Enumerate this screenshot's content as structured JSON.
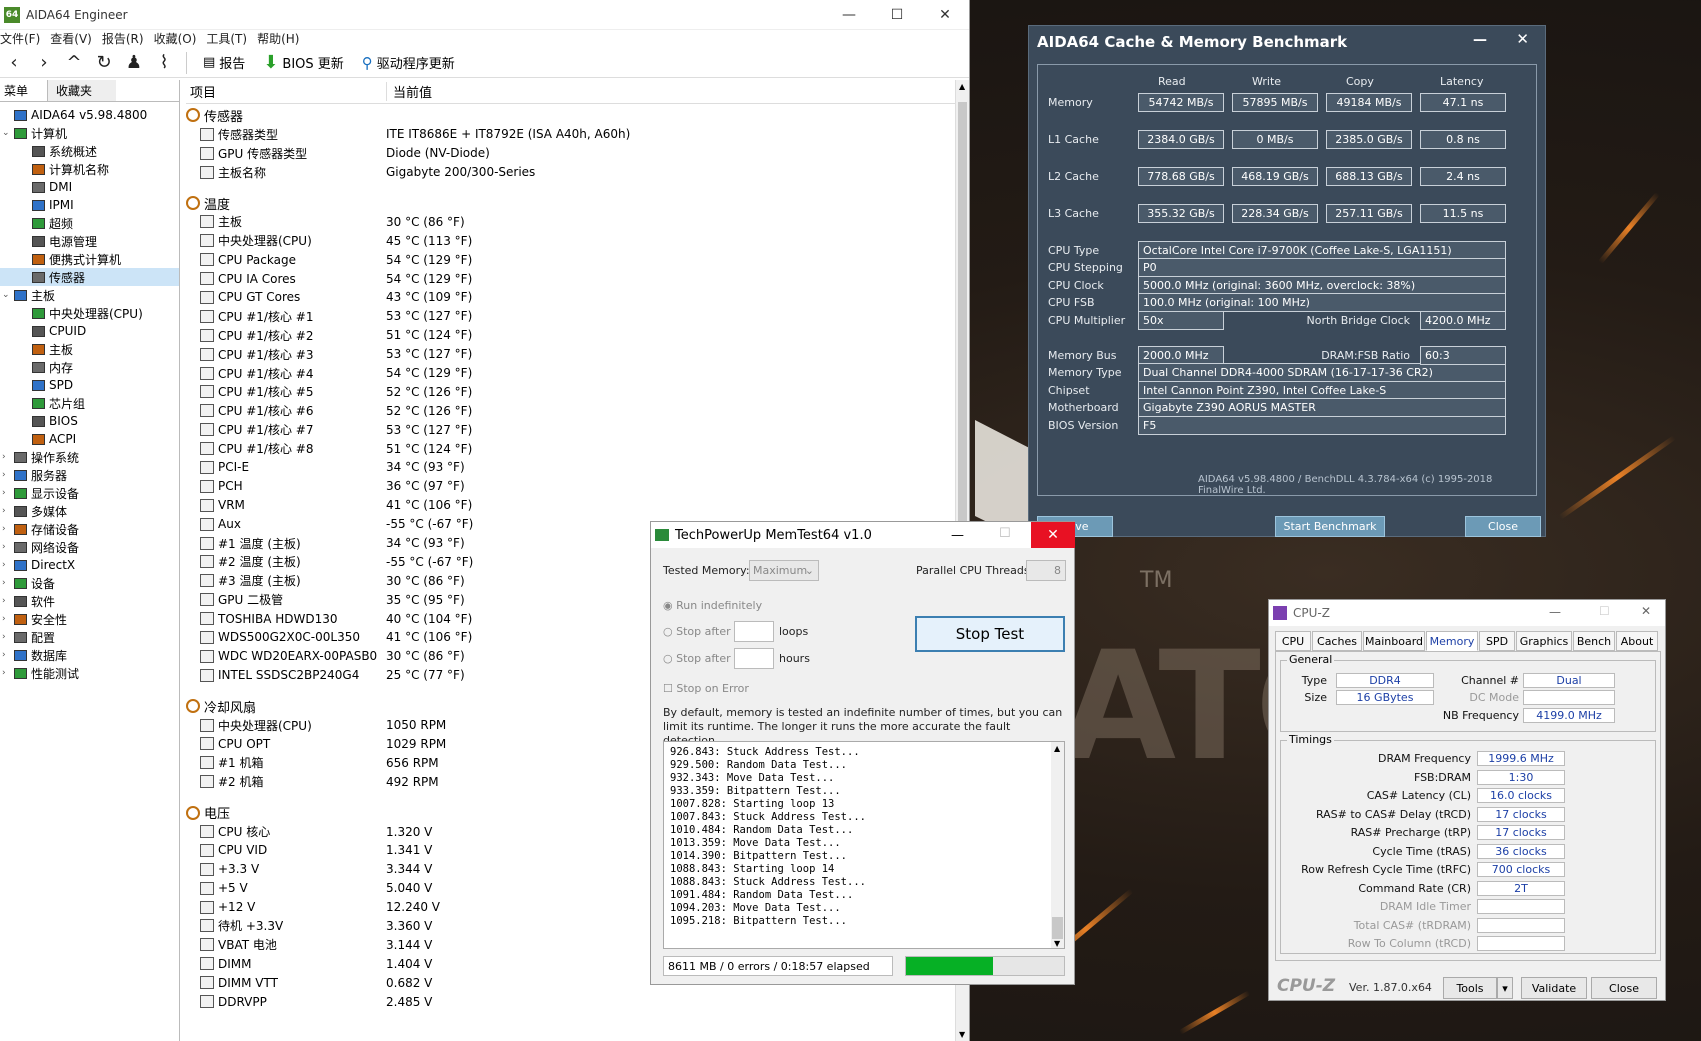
{
  "aida": {
    "window_title": "AIDA64 Engineer",
    "app_badge": "64",
    "menu": [
      "文件(F)",
      "查看(V)",
      "报告(R)",
      "收藏(O)",
      "工具(T)",
      "帮助(H)"
    ],
    "toolbar": {
      "report": "报告",
      "bios_update": "BIOS 更新",
      "driver_update": "驱动程序更新"
    },
    "side_tabs": [
      "菜单",
      "收藏夹"
    ],
    "tree": [
      {
        "label": "AIDA64 v5.98.4800",
        "level": 0,
        "arrow": ""
      },
      {
        "label": "计算机",
        "level": 0,
        "arrow": "v"
      },
      {
        "label": "系统概述",
        "level": 1,
        "arrow": ""
      },
      {
        "label": "计算机名称",
        "level": 1,
        "arrow": ""
      },
      {
        "label": "DMI",
        "level": 1,
        "arrow": ""
      },
      {
        "label": "IPMI",
        "level": 1,
        "arrow": ""
      },
      {
        "label": "超频",
        "level": 1,
        "arrow": ""
      },
      {
        "label": "电源管理",
        "level": 1,
        "arrow": ""
      },
      {
        "label": "便携式计算机",
        "level": 1,
        "arrow": ""
      },
      {
        "label": "传感器",
        "level": 1,
        "arrow": "",
        "selected": true
      },
      {
        "label": "主板",
        "level": 0,
        "arrow": "v"
      },
      {
        "label": "中央处理器(CPU)",
        "level": 1,
        "arrow": ""
      },
      {
        "label": "CPUID",
        "level": 1,
        "arrow": ""
      },
      {
        "label": "主板",
        "level": 1,
        "arrow": ""
      },
      {
        "label": "内存",
        "level": 1,
        "arrow": ""
      },
      {
        "label": "SPD",
        "level": 1,
        "arrow": ""
      },
      {
        "label": "芯片组",
        "level": 1,
        "arrow": ""
      },
      {
        "label": "BIOS",
        "level": 1,
        "arrow": ""
      },
      {
        "label": "ACPI",
        "level": 1,
        "arrow": ""
      },
      {
        "label": "操作系统",
        "level": 0,
        "arrow": ">"
      },
      {
        "label": "服务器",
        "level": 0,
        "arrow": ">"
      },
      {
        "label": "显示设备",
        "level": 0,
        "arrow": ">"
      },
      {
        "label": "多媒体",
        "level": 0,
        "arrow": ">"
      },
      {
        "label": "存储设备",
        "level": 0,
        "arrow": ">"
      },
      {
        "label": "网络设备",
        "level": 0,
        "arrow": ">"
      },
      {
        "label": "DirectX",
        "level": 0,
        "arrow": ">"
      },
      {
        "label": "设备",
        "level": 0,
        "arrow": ">"
      },
      {
        "label": "软件",
        "level": 0,
        "arrow": ">"
      },
      {
        "label": "安全性",
        "level": 0,
        "arrow": ">"
      },
      {
        "label": "配置",
        "level": 0,
        "arrow": ">"
      },
      {
        "label": "数据库",
        "level": 0,
        "arrow": ">"
      },
      {
        "label": "性能测试",
        "level": 0,
        "arrow": ">"
      }
    ],
    "col_item": "项目",
    "col_value": "当前值",
    "sections": [
      {
        "title": "传感器",
        "rows": [
          [
            "传感器类型",
            "ITE IT8686E + IT8792E  (ISA A40h, A60h)"
          ],
          [
            "GPU 传感器类型",
            "Diode  (NV-Diode)"
          ],
          [
            "主板名称",
            "Gigabyte 200/300-Series"
          ]
        ]
      },
      {
        "title": "温度",
        "rows": [
          [
            "主板",
            "30 °C  (86 °F)"
          ],
          [
            "中央处理器(CPU)",
            "45 °C  (113 °F)"
          ],
          [
            "CPU Package",
            "54 °C  (129 °F)"
          ],
          [
            "CPU IA Cores",
            "54 °C  (129 °F)"
          ],
          [
            "CPU GT Cores",
            "43 °C  (109 °F)"
          ],
          [
            "CPU #1/核心 #1",
            "53 °C  (127 °F)"
          ],
          [
            "CPU #1/核心 #2",
            "51 °C  (124 °F)"
          ],
          [
            "CPU #1/核心 #3",
            "53 °C  (127 °F)"
          ],
          [
            "CPU #1/核心 #4",
            "54 °C  (129 °F)"
          ],
          [
            "CPU #1/核心 #5",
            "52 °C  (126 °F)"
          ],
          [
            "CPU #1/核心 #6",
            "52 °C  (126 °F)"
          ],
          [
            "CPU #1/核心 #7",
            "53 °C  (127 °F)"
          ],
          [
            "CPU #1/核心 #8",
            "51 °C  (124 °F)"
          ],
          [
            "PCI-E",
            "34 °C  (93 °F)"
          ],
          [
            "PCH",
            "36 °C  (97 °F)"
          ],
          [
            "VRM",
            "41 °C  (106 °F)"
          ],
          [
            "Aux",
            "-55 °C  (-67 °F)"
          ],
          [
            "#1 温度 (主板)",
            "34 °C  (93 °F)"
          ],
          [
            "#2 温度 (主板)",
            "-55 °C  (-67 °F)"
          ],
          [
            "#3 温度 (主板)",
            "30 °C  (86 °F)"
          ],
          [
            "GPU 二极管",
            "35 °C  (95 °F)"
          ],
          [
            "TOSHIBA HDWD130",
            "40 °C  (104 °F)"
          ],
          [
            "WDS500G2X0C-00L350",
            "41 °C  (106 °F)"
          ],
          [
            "WDC WD20EARX-00PASB0",
            "30 °C  (86 °F)"
          ],
          [
            "INTEL SSDSC2BP240G4",
            "25 °C  (77 °F)"
          ]
        ]
      },
      {
        "title": "冷却风扇",
        "rows": [
          [
            "中央处理器(CPU)",
            "1050 RPM"
          ],
          [
            "CPU OPT",
            "1029 RPM"
          ],
          [
            "#1 机箱",
            "656 RPM"
          ],
          [
            "#2 机箱",
            "492 RPM"
          ]
        ]
      },
      {
        "title": "电压",
        "rows": [
          [
            "CPU 核心",
            "1.320 V"
          ],
          [
            "CPU VID",
            "1.341 V"
          ],
          [
            "+3.3 V",
            "3.344 V"
          ],
          [
            "+5 V",
            "5.040 V"
          ],
          [
            "+12 V",
            "12.240 V"
          ],
          [
            "待机 +3.3V",
            "3.360 V"
          ],
          [
            "VBAT 电池",
            "3.144 V"
          ],
          [
            "DIMM",
            "1.404 V"
          ],
          [
            "DIMM VTT",
            "0.682 V"
          ],
          [
            "DDRVPP",
            "2.485 V"
          ]
        ]
      }
    ]
  },
  "bench": {
    "title": "AIDA64 Cache & Memory Benchmark",
    "cols": [
      "Read",
      "Write",
      "Copy",
      "Latency"
    ],
    "rows": [
      {
        "label": "Memory",
        "vals": [
          "54742 MB/s",
          "57895 MB/s",
          "49184 MB/s",
          "47.1 ns"
        ]
      },
      {
        "label": "L1 Cache",
        "vals": [
          "2384.0 GB/s",
          "0 MB/s",
          "2385.0 GB/s",
          "0.8 ns"
        ]
      },
      {
        "label": "L2 Cache",
        "vals": [
          "778.68 GB/s",
          "468.19 GB/s",
          "688.13 GB/s",
          "2.4 ns"
        ]
      },
      {
        "label": "L3 Cache",
        "vals": [
          "355.32 GB/s",
          "228.34 GB/s",
          "257.11 GB/s",
          "11.5 ns"
        ]
      }
    ],
    "cpu_type_l": "CPU Type",
    "cpu_type": "OctalCore Intel Core i7-9700K  (Coffee Lake-S, LGA1151)",
    "cpu_stepping_l": "CPU Stepping",
    "cpu_stepping": "P0",
    "cpu_clock_l": "CPU Clock",
    "cpu_clock": "5000.0 MHz  (original: 3600 MHz, overclock: 38%)",
    "cpu_fsb_l": "CPU FSB",
    "cpu_fsb": "100.0 MHz  (original: 100 MHz)",
    "cpu_mult_l": "CPU Multiplier",
    "cpu_mult": "50x",
    "nb_clock_l": "North Bridge Clock",
    "nb_clock": "4200.0 MHz",
    "mem_bus_l": "Memory Bus",
    "mem_bus": "2000.0 MHz",
    "dram_ratio_l": "DRAM:FSB Ratio",
    "dram_ratio": "60:3",
    "mem_type_l": "Memory Type",
    "mem_type": "Dual Channel DDR4-4000 SDRAM  (16-17-17-36 CR2)",
    "chipset_l": "Chipset",
    "chipset": "Intel Cannon Point Z390, Intel Coffee Lake-S",
    "mobo_l": "Motherboard",
    "mobo": "Gigabyte Z390 AORUS MASTER",
    "bios_l": "BIOS Version",
    "bios": "F5",
    "footer": "AIDA64 v5.98.4800 / BenchDLL 4.3.784-x64  (c) 1995-2018 FinalWire Ltd.",
    "save": "Save",
    "start": "Start Benchmark",
    "close": "Close"
  },
  "memtest": {
    "title": "TechPowerUp MemTest64 v1.0",
    "tested_memory_l": "Tested Memory:",
    "tested_memory": "Maximum",
    "threads_l": "Parallel CPU Threads:",
    "threads": "8",
    "run_indef": "Run indefinitely",
    "stop_after": "Stop after",
    "loops": "loops",
    "hours": "hours",
    "stop_on_error": "Stop on Error",
    "stop_test": "Stop Test",
    "desc": "By default, memory is tested an indefinite number of times, but you can limit its runtime. The longer it runs the more accurate the fault detection.",
    "log": [
      "926.843: Stuck Address Test...",
      "929.500: Random Data Test...",
      "932.343: Move Data Test...",
      "933.359: Bitpattern Test...",
      "1007.828: Starting loop 13",
      "1007.843: Stuck Address Test...",
      "1010.484: Random Data Test...",
      "1013.359: Move Data Test...",
      "1014.390: Bitpattern Test...",
      "1088.843: Starting loop 14",
      "1088.843: Stuck Address Test...",
      "1091.484: Random Data Test...",
      "1094.203: Move Data Test...",
      "1095.218: Bitpattern Test..."
    ],
    "status": "8611 MB / 0 errors / 0:18:57 elapsed",
    "progress": 0.55
  },
  "cpuz": {
    "title": "CPU-Z",
    "tabs": [
      "CPU",
      "Caches",
      "Mainboard",
      "Memory",
      "SPD",
      "Graphics",
      "Bench",
      "About"
    ],
    "active_tab": "Memory",
    "general": "General",
    "type_l": "Type",
    "type": "DDR4",
    "size_l": "Size",
    "size": "16 GBytes",
    "channel_l": "Channel #",
    "channel": "Dual",
    "dcmode_l": "DC Mode",
    "nbfreq_l": "NB Frequency",
    "nbfreq": "4199.0 MHz",
    "timings": "Timings",
    "t": [
      [
        "DRAM Frequency",
        "1999.6 MHz"
      ],
      [
        "FSB:DRAM",
        "1:30"
      ],
      [
        "CAS# Latency (CL)",
        "16.0 clocks"
      ],
      [
        "RAS# to CAS# Delay (tRCD)",
        "17 clocks"
      ],
      [
        "RAS# Precharge (tRP)",
        "17 clocks"
      ],
      [
        "Cycle Time (tRAS)",
        "36 clocks"
      ],
      [
        "Row Refresh Cycle Time (tRFC)",
        "700 clocks"
      ],
      [
        "Command Rate (CR)",
        "2T"
      ],
      [
        "DRAM Idle Timer",
        ""
      ],
      [
        "Total CAS# (tRDRAM)",
        ""
      ],
      [
        "Row To Column (tRCD)",
        ""
      ]
    ],
    "brand": "CPU-Z",
    "version": "Ver. 1.87.0.x64",
    "tools": "Tools",
    "validate": "Validate",
    "close": "Close"
  },
  "desktop": {
    "deco": "ATC",
    "tm": "TM"
  }
}
